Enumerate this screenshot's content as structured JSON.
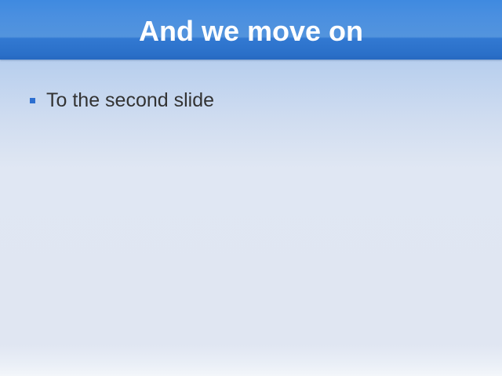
{
  "slide": {
    "title": "And we move on",
    "bullets": [
      {
        "text": "To the second slide"
      }
    ]
  },
  "colors": {
    "title_bar": "#3f8ae0",
    "title_text": "#ffffff",
    "bullet_marker": "#2d6fd0",
    "body_text": "#333333",
    "background_top": "#a9c6ec",
    "background_bottom": "#e0e6f2"
  },
  "icons": {
    "bullet": "square-bullet-icon"
  }
}
